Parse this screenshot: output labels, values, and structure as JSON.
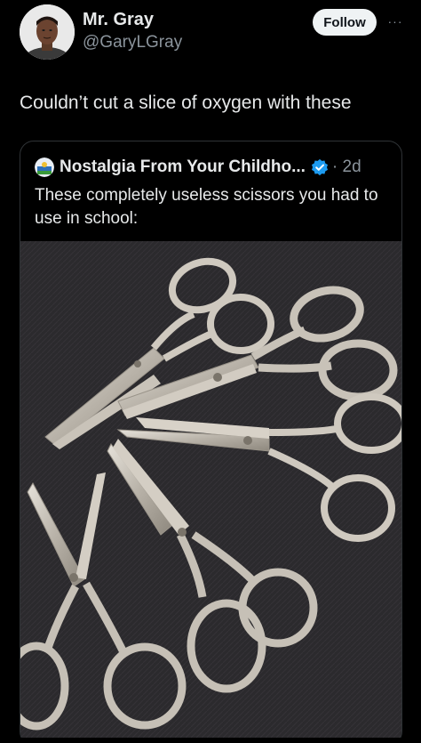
{
  "tweet": {
    "author_name": "Mr. Gray",
    "author_handle": "@GaryLGray",
    "follow_label": "Follow",
    "more_label": "···",
    "text": "Couldn’t cut a slice of oxygen with these"
  },
  "quoted_tweet": {
    "author_name": "Nostalgia From Your Childho...",
    "time": "· 2d",
    "text": "These completely useless scissors you had to use in school:",
    "image_description_icon": "scissors-photo"
  },
  "colors": {
    "background": "#000000",
    "text_primary": "#e7e9ea",
    "text_secondary": "#8b949c",
    "border": "#2f3336",
    "verified": "#1d9bf0",
    "follow_bg": "#eff3f4"
  }
}
